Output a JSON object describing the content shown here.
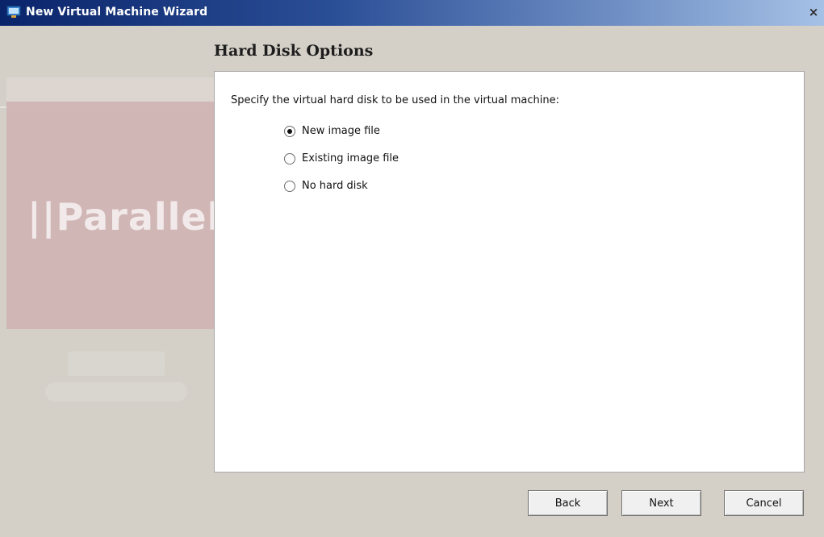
{
  "window": {
    "title": "New Virtual Machine Wizard",
    "close_glyph": "×"
  },
  "brand": {
    "logo_text": "Parallels"
  },
  "page": {
    "heading": "Hard Disk Options",
    "prompt": "Specify the virtual hard disk to be used in the virtual machine:"
  },
  "options": [
    {
      "label": "New image file",
      "selected": true
    },
    {
      "label": "Existing image file",
      "selected": false
    },
    {
      "label": "No hard disk",
      "selected": false
    }
  ],
  "buttons": {
    "back": "Back",
    "next": "Next",
    "cancel": "Cancel"
  },
  "colors": {
    "titlebar_start": "#0a246a",
    "titlebar_end": "#a6c1e6",
    "window_bg": "#d4d0c8"
  }
}
